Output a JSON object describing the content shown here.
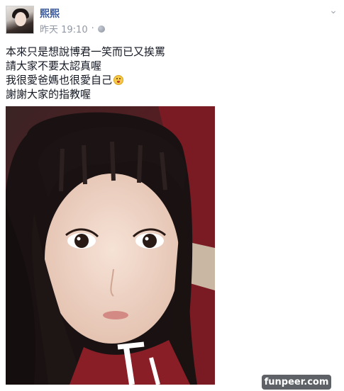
{
  "post": {
    "author": "熙熙",
    "timestamp": "昨天 19:10",
    "privacy_icon": "globe-icon",
    "lines": [
      "本來只是想說博君一笑而已又挨罵",
      "請大家不要太認真喔",
      "我很愛爸媽也很愛自己",
      "謝謝大家的指教喔"
    ],
    "emoji": "smiling-emoji-icon",
    "photo": "selfie-photo"
  },
  "watermark": "funpeer.com",
  "colors": {
    "author_blue": "#3b5998",
    "meta_gray": "#9197a3",
    "watermark_bg": "#5e6266"
  }
}
